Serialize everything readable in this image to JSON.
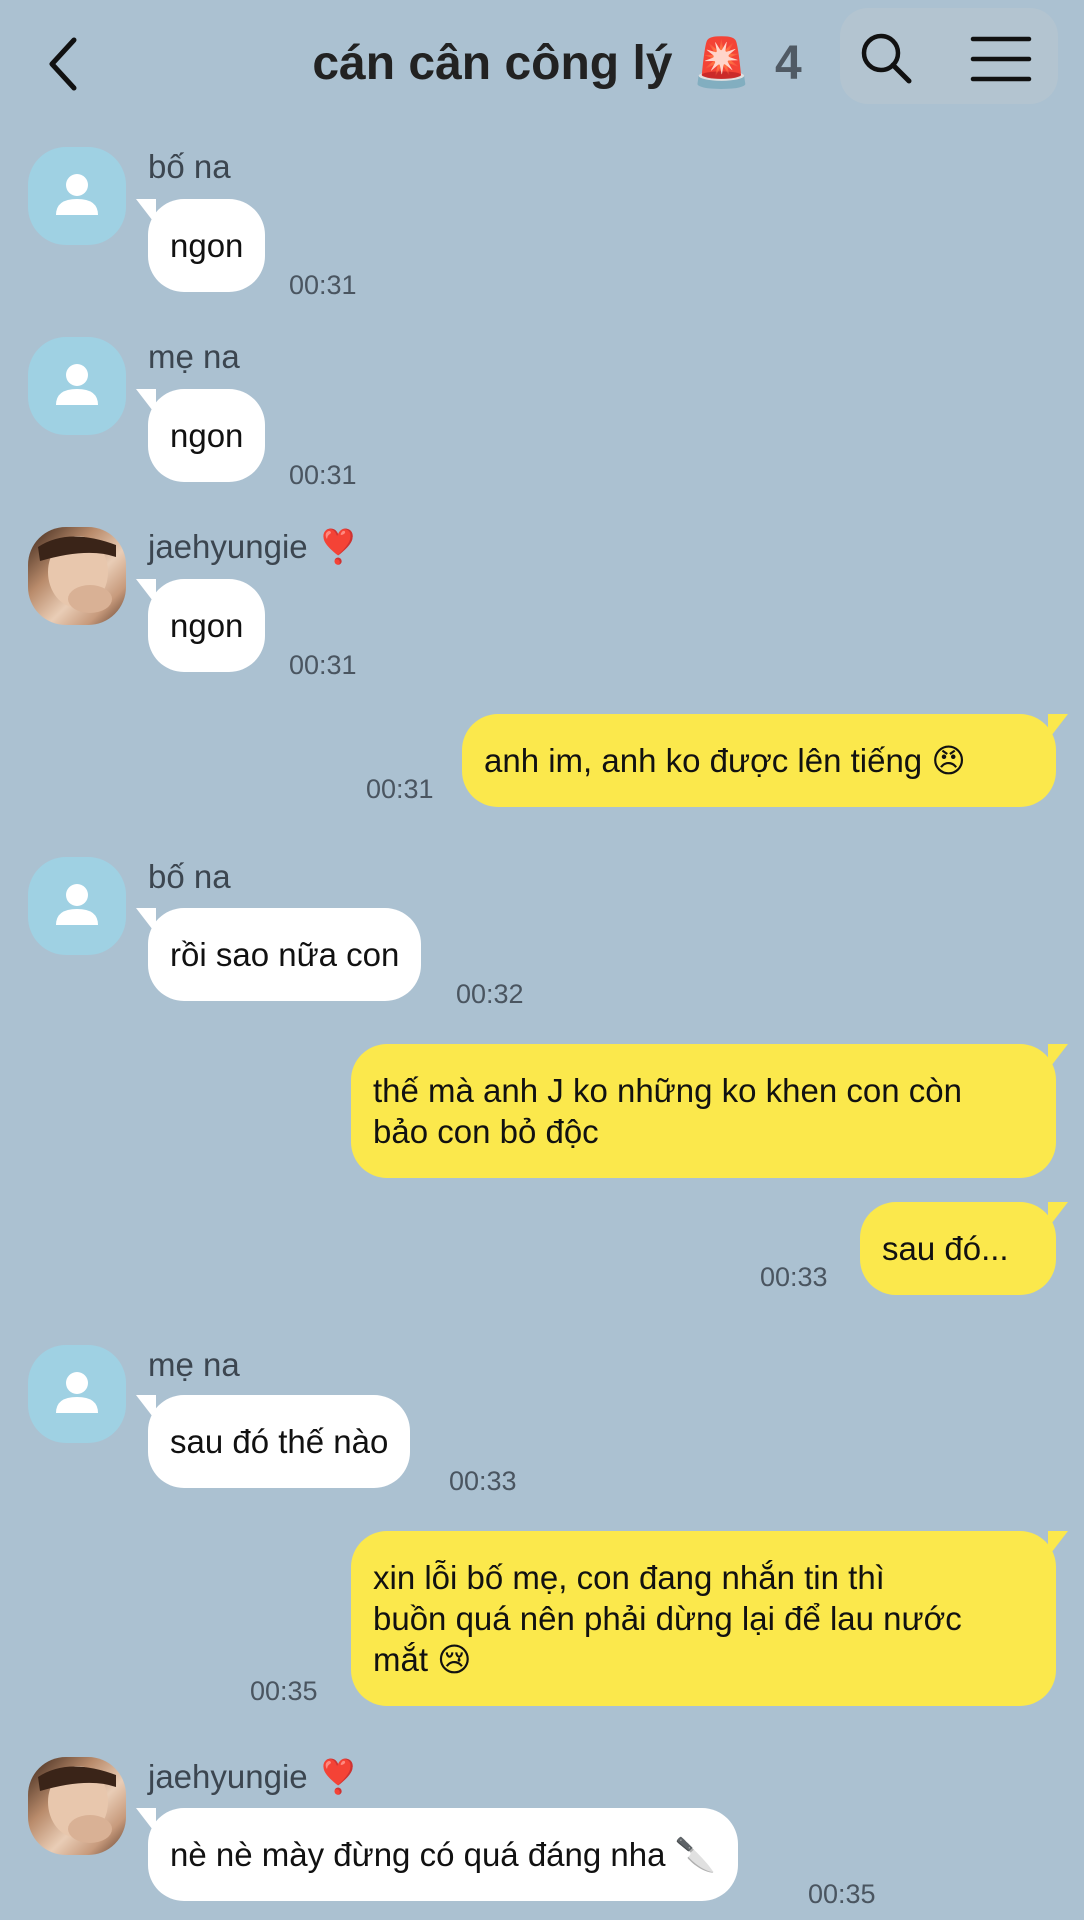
{
  "header": {
    "title": "cán cân công lý",
    "title_emoji": "🚨",
    "member_count": "4",
    "back_icon": "chevron-left-icon",
    "search_icon": "search-icon",
    "menu_icon": "hamburger-menu-icon"
  },
  "messages": [
    {
      "sender": "bố na",
      "text": "ngon",
      "time": "00:31",
      "avatar": "default-avatar"
    },
    {
      "sender": "mẹ na",
      "text": "ngon",
      "time": "00:31",
      "avatar": "default-avatar"
    },
    {
      "sender": "jaehyungie",
      "sender_badge": "❣️",
      "text": "ngon",
      "time": "00:31",
      "avatar": "photo-avatar"
    },
    {
      "text": "anh im, anh ko được lên tiếng 😠",
      "time": "00:31"
    },
    {
      "sender": "bố na",
      "text": "rồi sao nữa con",
      "time": "00:32",
      "avatar": "default-avatar"
    },
    {
      "text_line1": "thế mà anh J ko những ko khen con còn",
      "text_line2": "bảo con bỏ độc"
    },
    {
      "text": "sau đó...",
      "time": "00:33"
    },
    {
      "sender": "mẹ na",
      "text": "sau đó thế nào",
      "time": "00:33",
      "avatar": "default-avatar"
    },
    {
      "text_line1": "xin lỗi bố mẹ, con đang nhắn tin thì",
      "text_line2": "buồn quá nên phải dừng lại để lau nước",
      "text_line3": "mắt 😢",
      "time": "00:35"
    },
    {
      "sender": "jaehyungie",
      "sender_badge": "❣️",
      "text": "nè nè mày đừng có quá đáng nha 🔪",
      "time": "00:35",
      "avatar": "photo-avatar"
    }
  ],
  "colors": {
    "background": "#abc1d1",
    "incoming_bubble": "#ffffff",
    "outgoing_bubble": "#fbe84c",
    "default_avatar": "#9fd1e3"
  }
}
